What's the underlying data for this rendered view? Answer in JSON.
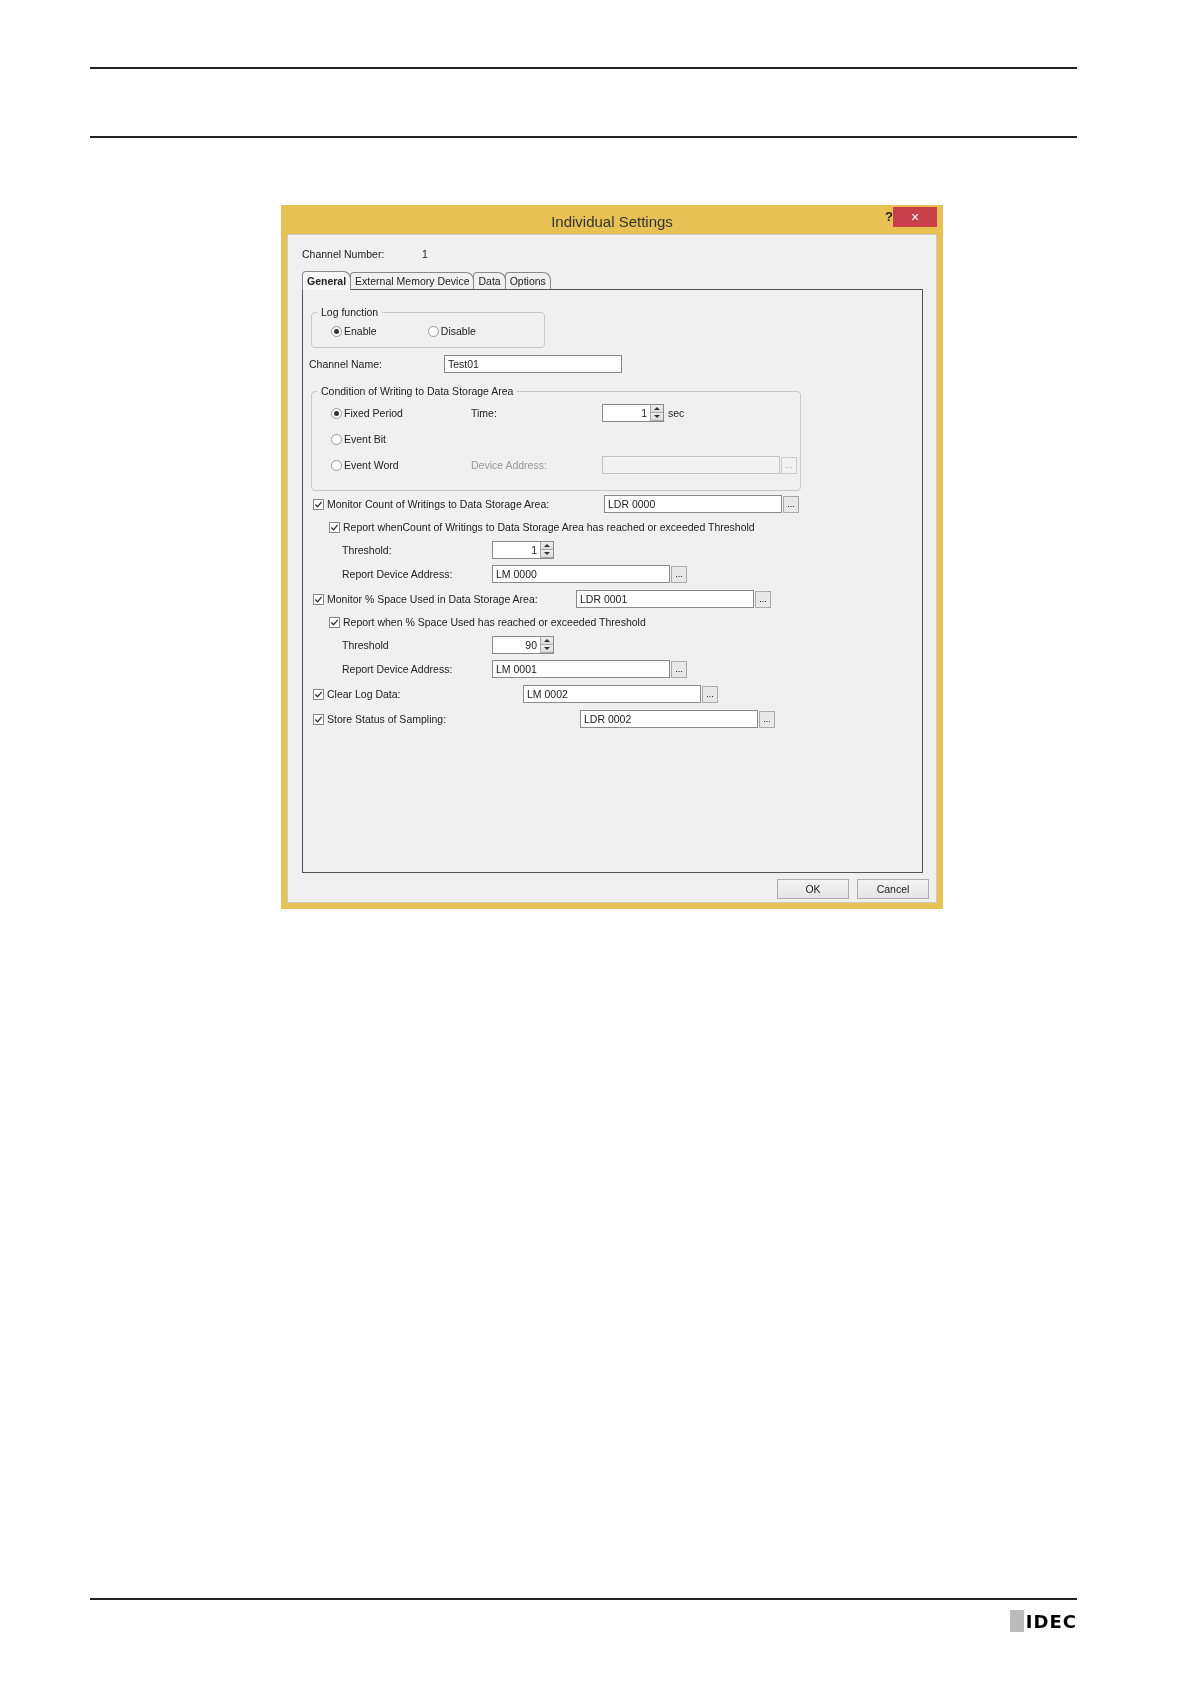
{
  "logo": "IDEC",
  "dialog": {
    "title": "Individual Settings",
    "help_button": "?",
    "close_button": "×",
    "channel_number": {
      "label": "Channel Number:",
      "value": "1"
    },
    "tabs": [
      {
        "label": "General",
        "selected": true
      },
      {
        "label": "External Memory Device",
        "selected": false
      },
      {
        "label": "Data",
        "selected": false
      },
      {
        "label": "Options",
        "selected": false
      }
    ],
    "log_function": {
      "legend": "Log function",
      "options": [
        {
          "label": "Enable",
          "selected": true
        },
        {
          "label": "Disable",
          "selected": false
        }
      ]
    },
    "channel_name": {
      "label": "Channel Name:",
      "value": "Test01"
    },
    "condition": {
      "legend": "Condition of Writing to Data Storage Area",
      "options": [
        {
          "label": "Fixed Period",
          "selected": true
        },
        {
          "label": "Event Bit",
          "selected": false
        },
        {
          "label": "Event Word",
          "selected": false
        }
      ],
      "time": {
        "label": "Time:",
        "value": "1",
        "unit": "sec"
      },
      "device_address": {
        "label": "Device Address:",
        "disabled": true,
        "button": "..."
      }
    },
    "settings": [
      {
        "label": "Monitor Count of Writings to Data Storage Area:",
        "checked": true,
        "value": "LDR 0000",
        "button": "...",
        "children": [
          {
            "kind": "check",
            "label": "Report whenCount of Writings to Data Storage Area has reached or exceeded Threshold",
            "checked": true
          },
          {
            "kind": "spin",
            "label": "Threshold:",
            "value": "1"
          },
          {
            "kind": "address",
            "label": "Report Device Address:",
            "value": "LM 0000",
            "button": "..."
          }
        ]
      },
      {
        "label": "Monitor % Space Used in Data Storage Area:",
        "checked": true,
        "value": "LDR 0001",
        "button": "...",
        "children": [
          {
            "kind": "check",
            "label": "Report when % Space Used has reached or exceeded Threshold",
            "checked": true
          },
          {
            "kind": "spin",
            "label": "Threshold",
            "value": "90"
          },
          {
            "kind": "address",
            "label": "Report Device Address:",
            "value": "LM 0001",
            "button": "..."
          }
        ]
      },
      {
        "label": "Clear Log Data:",
        "checked": true,
        "value": "LM 0002",
        "button": "..."
      },
      {
        "label": "Store Status of Sampling:",
        "checked": true,
        "value": "LDR 0002",
        "button": "..."
      }
    ],
    "buttons": [
      "OK",
      "Cancel"
    ]
  }
}
